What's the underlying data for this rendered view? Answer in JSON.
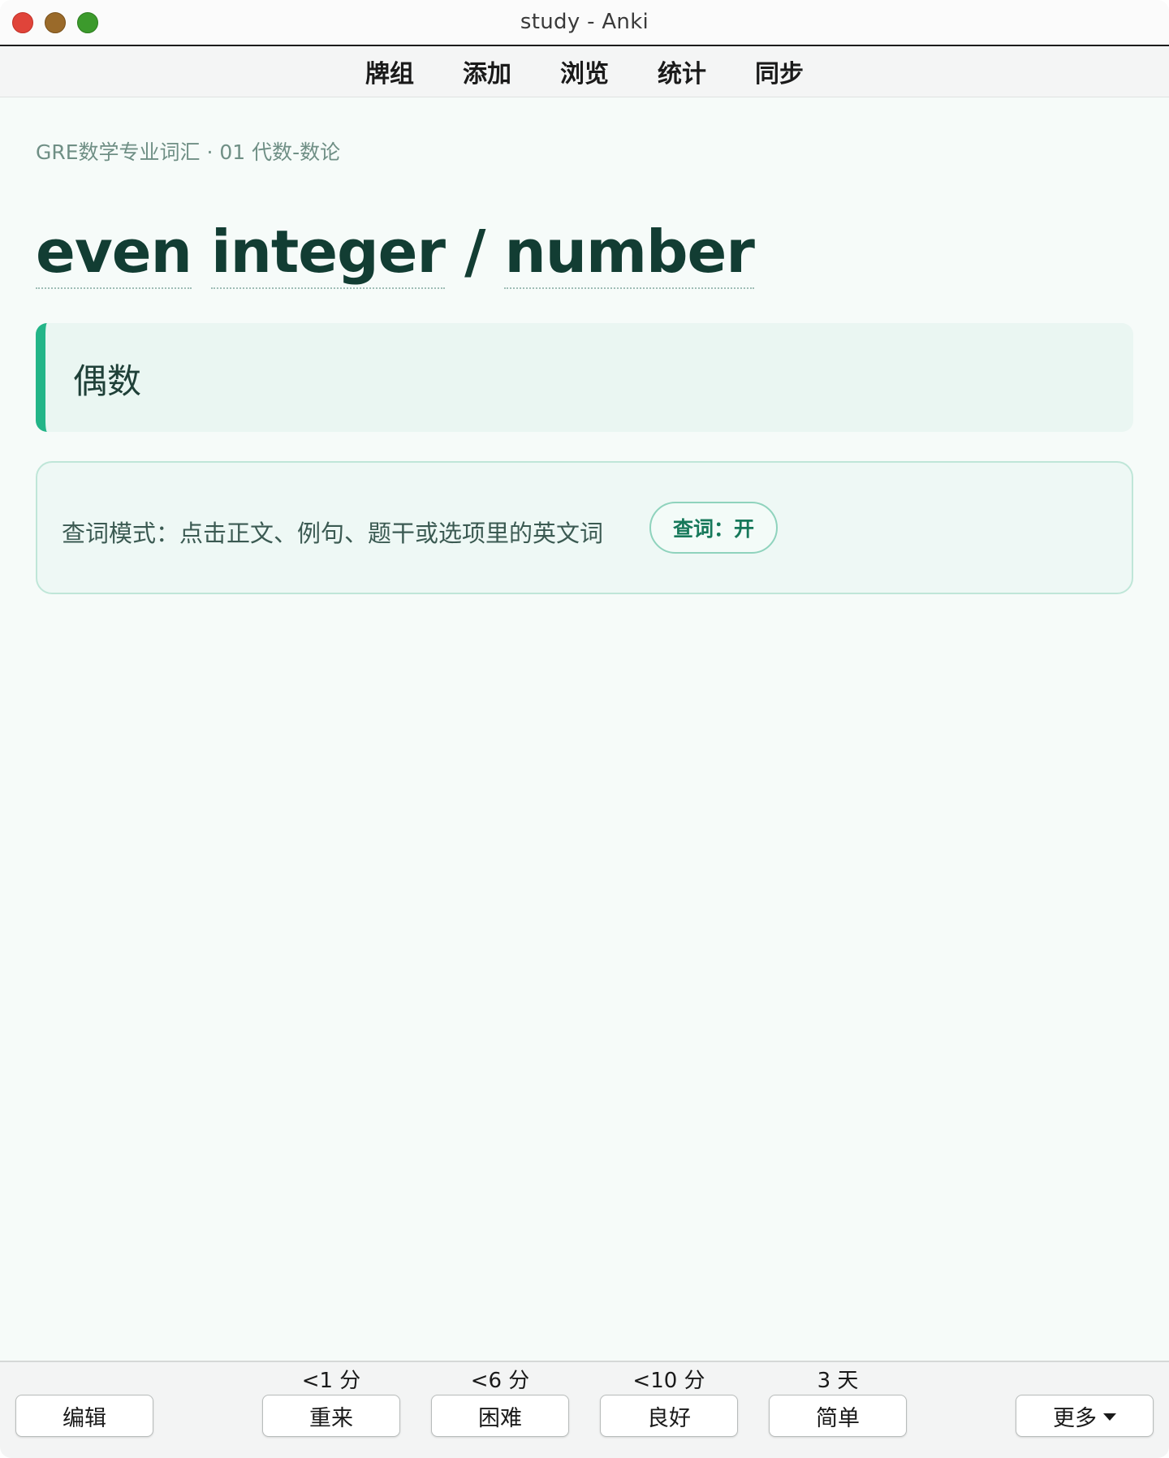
{
  "window": {
    "title": "study - Anki"
  },
  "toolbar": {
    "items": [
      "牌组",
      "添加",
      "浏览",
      "统计",
      "同步"
    ]
  },
  "card": {
    "breadcrumb": "GRE数学专业词汇 · 01 代数-数论",
    "term_words": [
      "even",
      "integer",
      "/",
      "number"
    ],
    "definition": "偶数",
    "lookup_hint": "查词模式：点击正文、例句、题干或选项里的英文词",
    "lookup_toggle": "查词：开"
  },
  "answer_bar": {
    "edit_label": "编辑",
    "more_label": "更多",
    "buttons": [
      {
        "label": "重来",
        "interval": "<1 分"
      },
      {
        "label": "困难",
        "interval": "<6 分"
      },
      {
        "label": "良好",
        "interval": "<10 分"
      },
      {
        "label": "简单",
        "interval": "3 天"
      }
    ]
  },
  "colors": {
    "accent": "#23b588",
    "title_text": "#123d33",
    "toggle_text": "#16785a",
    "background": "#f6fbf9"
  }
}
